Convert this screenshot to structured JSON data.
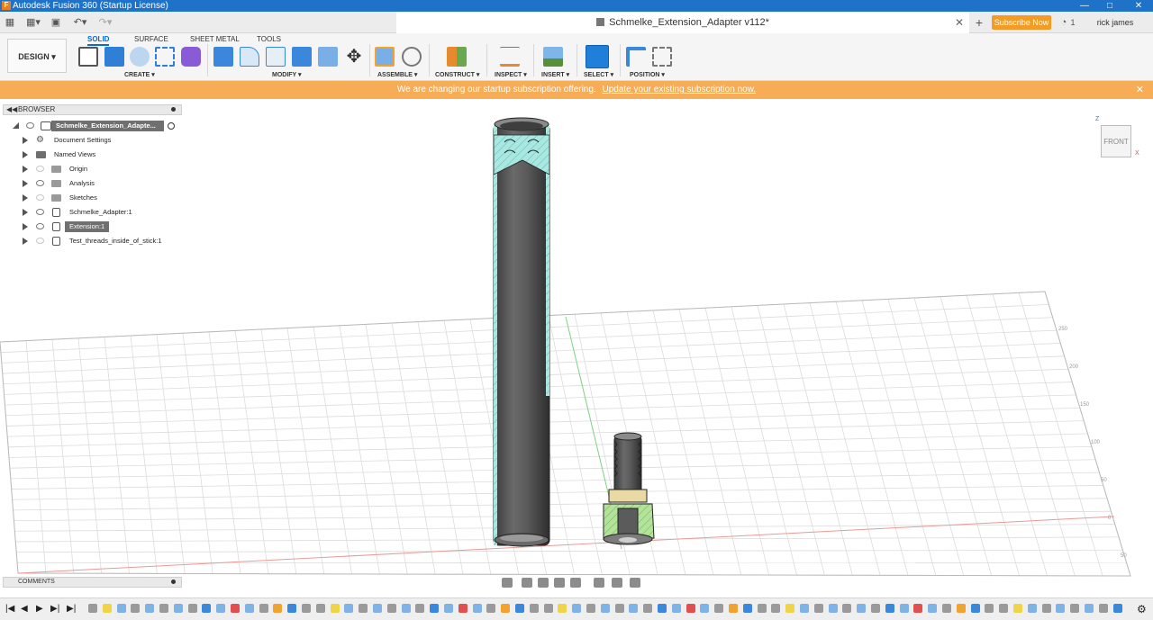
{
  "window": {
    "title": "Autodesk Fusion 360 (Startup License)",
    "app_icon": "F"
  },
  "tabbar": {
    "doc_title": "Schmelke_Extension_Adapter v112*",
    "subscribe_label": "Subscribe Now",
    "job_count": "1",
    "user_name": "rick james"
  },
  "toolbar": {
    "workspace": "DESIGN",
    "tabs": [
      "SOLID",
      "SURFACE",
      "SHEET METAL",
      "TOOLS"
    ],
    "active_tab": "SOLID",
    "groups": [
      "CREATE",
      "MODIFY",
      "ASSEMBLE",
      "CONSTRUCT",
      "INSPECT",
      "INSERT",
      "SELECT",
      "POSITION"
    ]
  },
  "banner": {
    "text": "We are changing our startup subscription offering.",
    "link": "Update your existing subscription now."
  },
  "browser": {
    "title": "BROWSER",
    "root": "Schmelke_Extension_Adapte...",
    "items": [
      {
        "label": "Document Settings",
        "icon": "gear-icon",
        "indent": 1
      },
      {
        "label": "Named Views",
        "icon": "folder-icon",
        "indent": 1
      },
      {
        "label": "Origin",
        "icon": "folder-icon",
        "indent": 2
      },
      {
        "label": "Analysis",
        "icon": "folder-icon",
        "indent": 2
      },
      {
        "label": "Sketches",
        "icon": "folder-icon",
        "indent": 2
      },
      {
        "label": "Schmelke_Adapter:1",
        "icon": "component-icon",
        "indent": 2
      },
      {
        "label": "Extension:1",
        "icon": "component-icon",
        "indent": 2,
        "selected": true
      },
      {
        "label": "Test_threads_inside_of_stick:1",
        "icon": "component-icon",
        "indent": 2
      }
    ]
  },
  "comments": {
    "title": "COMMENTS"
  },
  "viewcube": {
    "face": "FRONT",
    "x_axis": "X",
    "z_axis": "Z"
  },
  "grid_labels": [
    "250",
    "200",
    "150",
    "100",
    "50",
    "0",
    "50"
  ],
  "colors": {
    "titlebar": "#1e73c8",
    "banner": "#f6ad55",
    "subscribe": "#f29c25",
    "accent": "#0a6ad6",
    "section_hatch": "#9fe3dc",
    "section_green": "#a7e08a",
    "body_dark": "#4f4f4f"
  }
}
